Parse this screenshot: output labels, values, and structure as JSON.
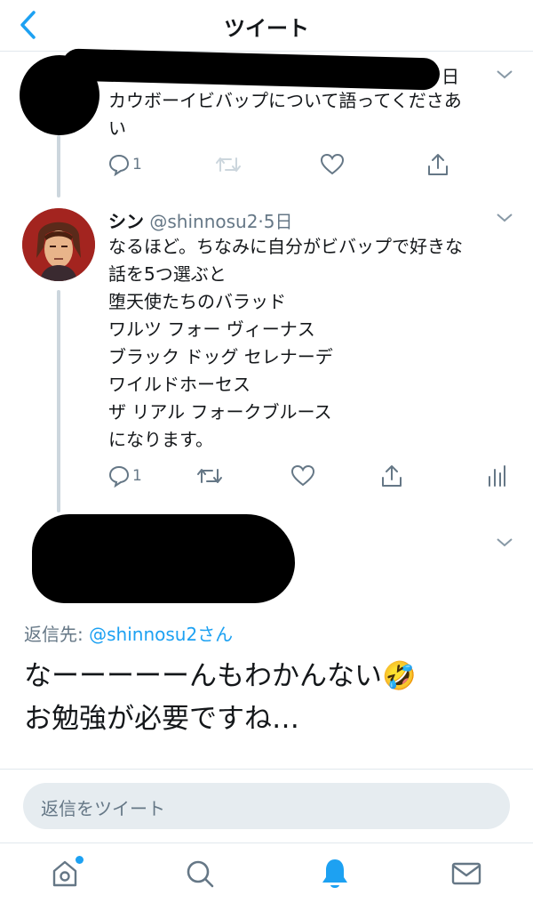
{
  "header": {
    "title": "ツイート"
  },
  "tweet1": {
    "date_fragment": "日",
    "text_lines": [
      "カウボーイビバップについて語ってくださあ",
      "い"
    ],
    "reply_count": "1"
  },
  "tweet2": {
    "name": "シン",
    "handle": "@shinnosu2",
    "separator": "·",
    "date": "5日",
    "text_lines": [
      "なるほど。ちなみに自分がビバップで好きな",
      "話を5つ選ぶと",
      "堕天使たちのバラッド",
      "ワルツ フォー ヴィーナス",
      "ブラック ドッグ セレナーデ",
      "ワイルドホーセス",
      "ザ リアル フォークブルース",
      "になります。"
    ],
    "reply_count": "1"
  },
  "reply": {
    "reply_to_label": "返信先: ",
    "reply_to_mention": "@shinnosu2さん",
    "line1": "なーーーーーんもわかんない🤣",
    "line2": "お勉強が必要ですね…"
  },
  "composer": {
    "placeholder": "返信をツイート"
  },
  "tabbar": {
    "items": [
      "home-icon",
      "search-icon",
      "notifications-icon",
      "messages-icon"
    ]
  },
  "colors": {
    "accent": "#1da1f2",
    "icon": "#657786",
    "text": "#14171a"
  }
}
